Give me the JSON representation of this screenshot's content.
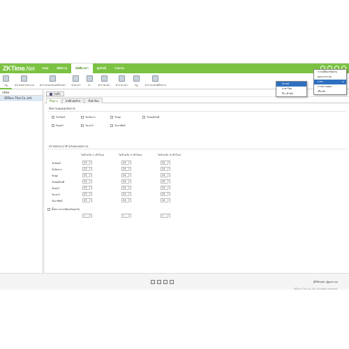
{
  "app": {
    "logo_main": "ZKTime",
    "logo_net": ".Net"
  },
  "nav": [
    {
      "label": "ระบบ"
    },
    {
      "label": "พนักงาน"
    },
    {
      "label": "บันทึกเวลา"
    },
    {
      "label": "อุปกรณ์"
    },
    {
      "label": "รายงาน"
    }
  ],
  "toolbar": [
    {
      "label": "กฎ"
    },
    {
      "label": "ประเภทการลางาน"
    },
    {
      "label": "ตารางเวลาแบบปรับเวลา"
    },
    {
      "label": "ช่วงเวลา"
    },
    {
      "label": "กะ"
    },
    {
      "label": "ตารางเวลา"
    },
    {
      "label": "ตารางเวลา"
    },
    {
      "label": "กฎ"
    },
    {
      "label": "ตารางเวลาพนักงาน"
    }
  ],
  "left_panel": {
    "header": "บริษัท",
    "company": "ZKTeco Thai Co.,Ltd."
  },
  "content": {
    "save_label": "บันทึก",
    "tabs": [
      {
        "label": "พื้นฐาน"
      },
      {
        "label": "บันทึกสุดท้าย"
      },
      {
        "label": "ตั้งค่าอื่นๆ"
      }
    ],
    "weekend_title": "ตั้งค่าวันหยุดสุดสัปดาห์",
    "weekend_days": [
      {
        "label": "วันจันทร์"
      },
      {
        "label": "วันอังคาร"
      },
      {
        "label": "วันพุธ"
      },
      {
        "label": "วันพฤหัสบดี"
      },
      {
        "label": "วันศุกร์"
      },
      {
        "label": "วันเสาร์"
      },
      {
        "label": "วันอาทิตย์"
      }
    ],
    "cross_title": "ตรวจสอบเวลาข้ามวันของพนักงาน",
    "columns": [
      {
        "label": "ไม่ข้ามวัน 1 (ชั่วโมง)"
      },
      {
        "label": "ไม่ข้ามวัน 2 (ชั่วโมง)"
      },
      {
        "label": "ไม่ข้ามวัน 3 (ชั่วโมง)"
      }
    ],
    "rows": [
      {
        "day": "วันจันทร์",
        "v": [
          "23",
          "24",
          "24"
        ]
      },
      {
        "day": "วันอังคาร",
        "v": [
          "23",
          "24",
          "24"
        ]
      },
      {
        "day": "วันพุธ",
        "v": [
          "23",
          "24",
          "24"
        ]
      },
      {
        "day": "วันพฤหัสบดี",
        "v": [
          "23",
          "24",
          "24"
        ]
      },
      {
        "day": "วันศุกร์",
        "v": [
          "23",
          "24",
          "24"
        ]
      },
      {
        "day": "วันเสาร์",
        "v": [
          "23",
          "24",
          "24"
        ]
      },
      {
        "day": "วันอาทิตย์",
        "v": [
          "23",
          "24",
          "24"
        ]
      }
    ],
    "same_setting_label": "ตั้งค่าเวลาเหมือนกันทุกวัน",
    "disabled_values": [
      "0",
      "0",
      "0"
    ]
  },
  "footer": {
    "right_line1": "ผู้ใช้ปัจจุบัน: ผู้ดูแลระบบ",
    "right_line2": "ZKTeco Thai Co.,Ltd. All rights reserved."
  },
  "menu": {
    "items": [
      {
        "label": "การเปลี่ยนรหัสผ่าน"
      },
      {
        "label": "ออกจากระบบ"
      },
      {
        "label": "ภาษา"
      },
      {
        "label": "การตรวจสอบ"
      },
      {
        "label": "เกี่ยวกับ"
      }
    ],
    "submenu": [
      {
        "label": "อังกฤษ"
      },
      {
        "label": "ภาษาไทย"
      },
      {
        "label": "จีน (ตัวย่อ)"
      }
    ]
  },
  "colors": {
    "brand_green": "#7cc242",
    "menu_highlight": "#2f6fc0",
    "selection_row": "#dde8f5"
  }
}
